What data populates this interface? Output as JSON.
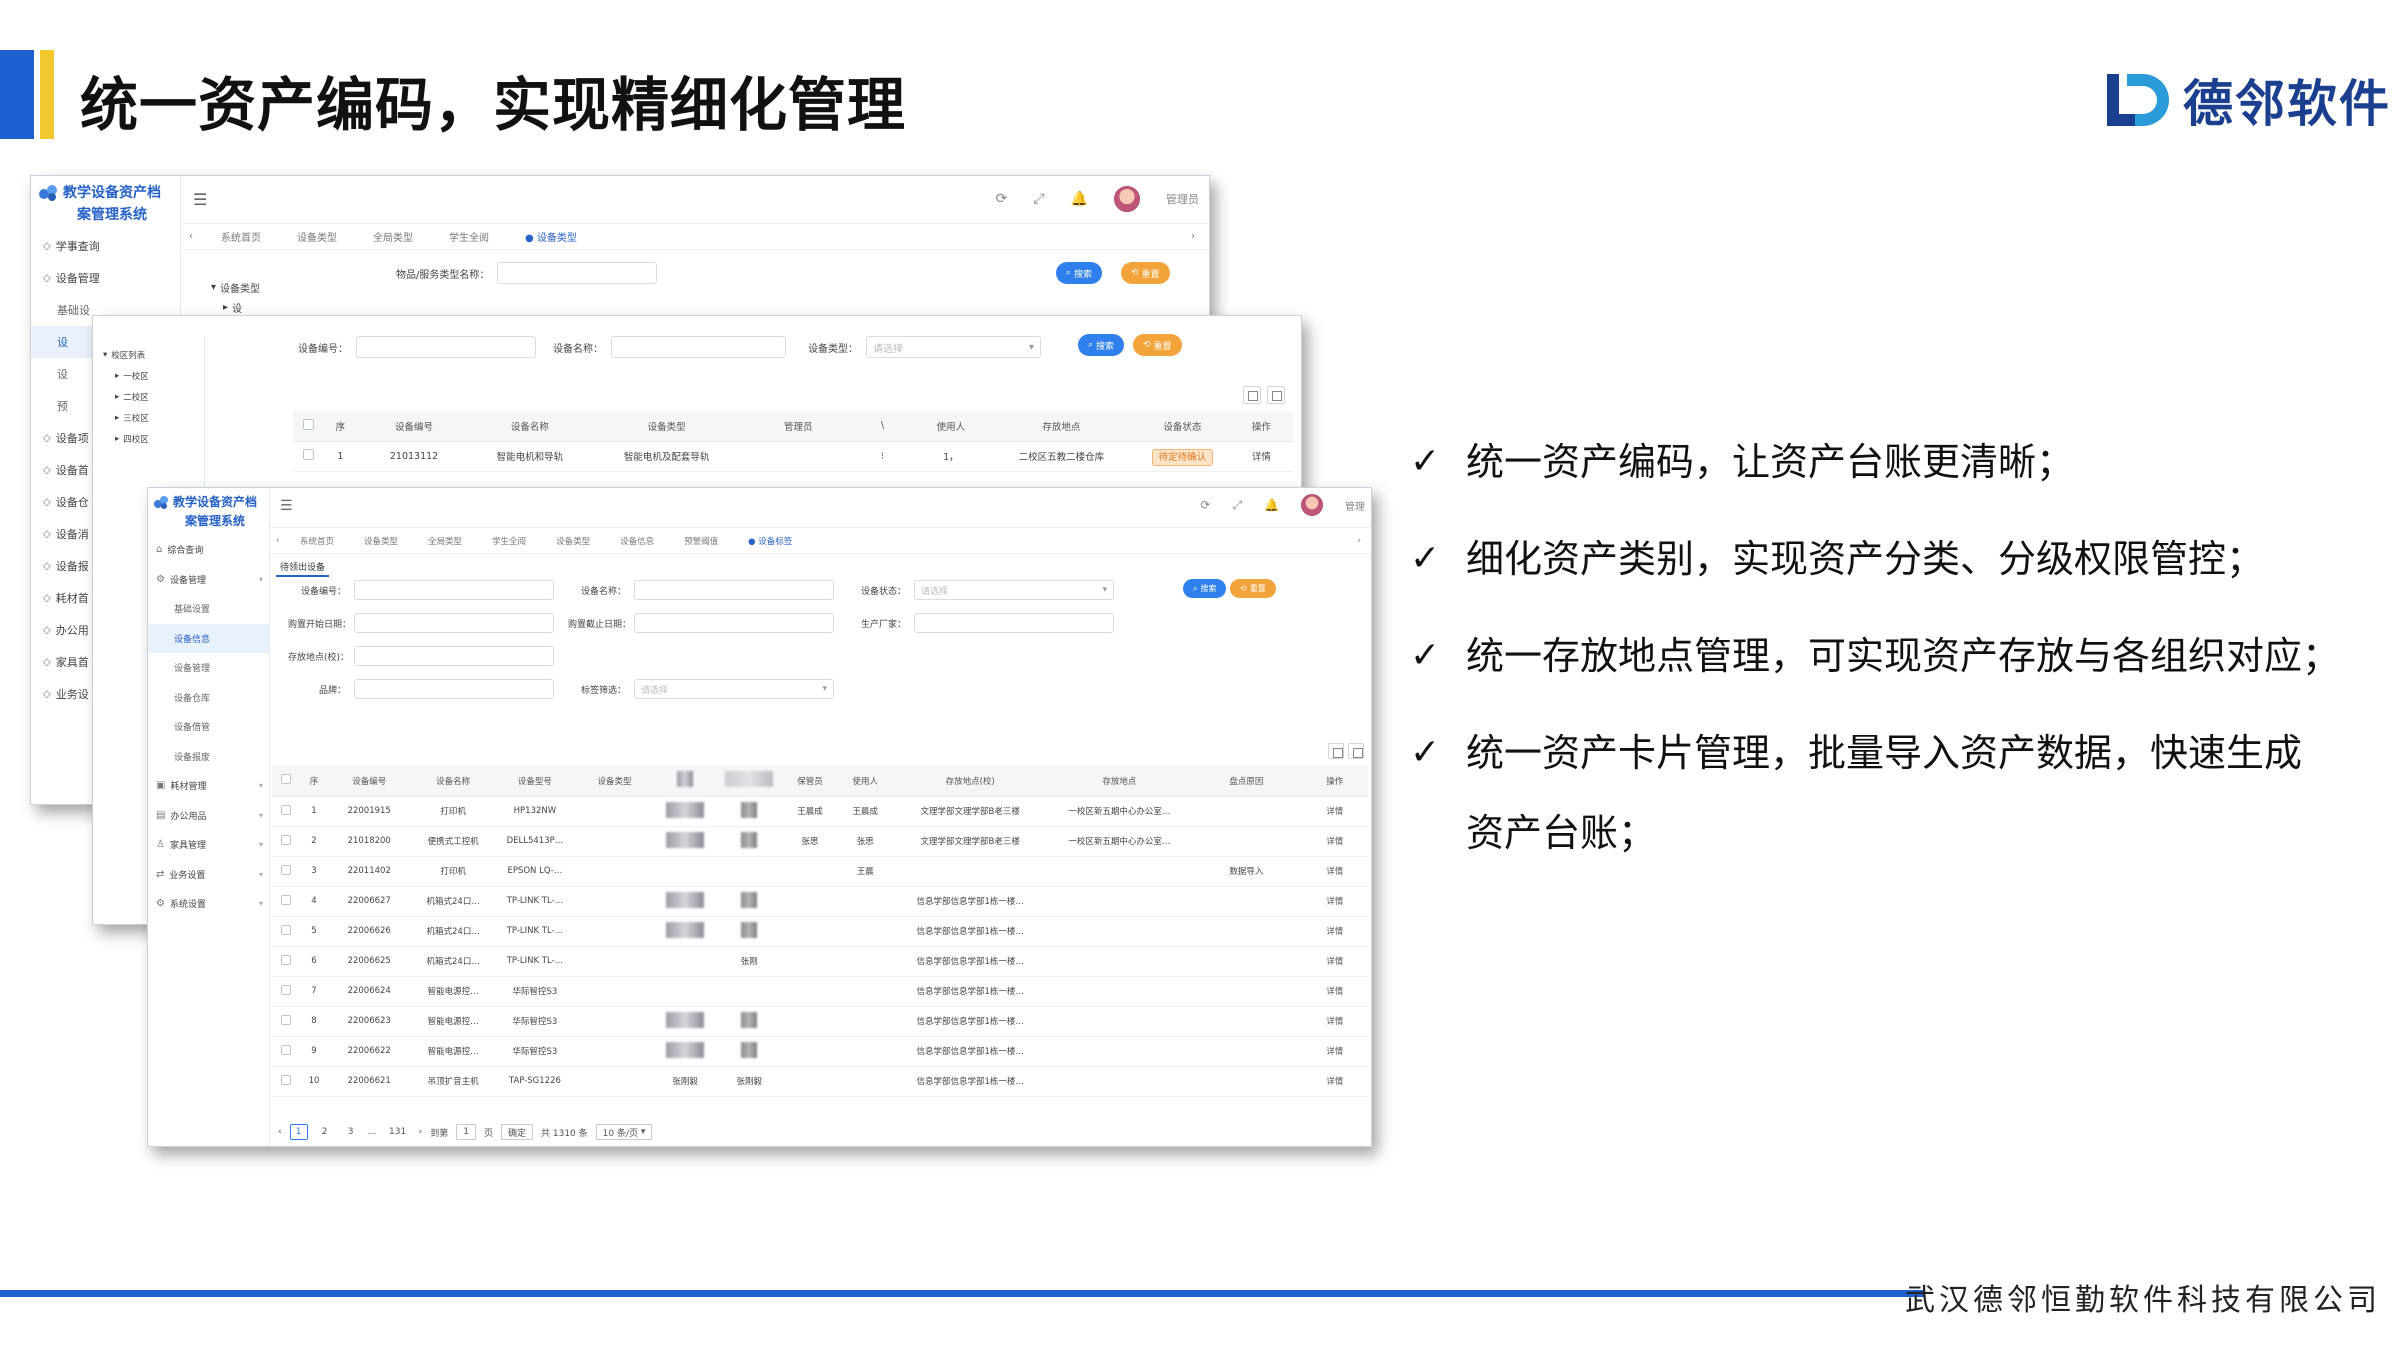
{
  "slide": {
    "title": "统一资产编码，实现精细化管理",
    "brand_name": "德邻软件",
    "company": "武汉德邻恒勤软件科技有限公司",
    "colors": {
      "accent_blue": "#1e5fcf",
      "accent_yellow": "#f3c72e",
      "brand": "#1a3f8f"
    }
  },
  "bullets": [
    {
      "icon": "check-icon",
      "glyph": "✓",
      "text": "统一资产编码，让资产台账更清晰；"
    },
    {
      "icon": "check-icon",
      "glyph": "✓",
      "text": "细化资产类别，实现资产分类、分级权限管控；"
    },
    {
      "icon": "check-icon",
      "glyph": "✓",
      "text": "统一存放地点管理，可实现资产存放与各组织对应；"
    },
    {
      "icon": "check-icon",
      "glyph": "✓",
      "text": "统一资产卡片管理，批量导入资产数据，快速生成"
    },
    {
      "icon": "",
      "glyph": "",
      "text": "资产台账；"
    }
  ],
  "win1": {
    "system_name_1": "教学设备资产档",
    "system_name_2": "案管理系统",
    "nav": [
      "学事查询",
      "设备管理",
      "基础设",
      "设",
      "设",
      "预",
      "设备项",
      "设备首",
      "设备仓",
      "设备消",
      "设备报",
      "耗材首",
      "办公用",
      "家具首",
      "业务设"
    ],
    "tabs": [
      "系统首页",
      "设备类型",
      "全局类型",
      "学生全阅",
      "设备类型"
    ],
    "search_label": "物品/服务类型名称：",
    "search_btn": "搜索",
    "reset_btn": "重置",
    "tree_root": "设备类型",
    "tree_child": "设",
    "user": "管理员"
  },
  "win2": {
    "field_code": "设备编号：",
    "field_name": "设备名称：",
    "field_type": "设备类型：",
    "type_placeholder": "请选择",
    "search_btn": "搜索",
    "reset_btn": "重置",
    "user": "管理",
    "tree": [
      "校区列表",
      "一校区",
      "二校区",
      "三校区",
      "四校区"
    ],
    "columns": [
      "序",
      "设备编号",
      "设备名称",
      "设备类型",
      "管理员",
      "\\",
      "使用人",
      "存放地点",
      "设备状态",
      "操作"
    ],
    "row": {
      "no": "1",
      "code": "21013112",
      "name": "智能电机和导轨",
      "type": "智能电机及配套导轨",
      "user": "1，",
      "place": "二校区五教二楼仓库",
      "status": "待定待确认",
      "op": "详情"
    }
  },
  "win3": {
    "system_name_1": "教学设备资产档",
    "system_name_2": "案管理系统",
    "user": "管理",
    "nav": [
      {
        "icon": "home-icon",
        "label": "综合查询"
      },
      {
        "icon": "gear-icon",
        "label": "设备管理"
      },
      {
        "icon": "",
        "label": "基础设置",
        "sub": true
      },
      {
        "icon": "",
        "label": "设备信息",
        "sub": true,
        "active": true
      },
      {
        "icon": "",
        "label": "设备管理",
        "sub": true
      },
      {
        "icon": "",
        "label": "设备仓库",
        "sub": true
      },
      {
        "icon": "",
        "label": "设备借管",
        "sub": true
      },
      {
        "icon": "",
        "label": "设备报废",
        "sub": true
      },
      {
        "icon": "box-icon",
        "label": "耗材管理"
      },
      {
        "icon": "briefcase-icon",
        "label": "办公用品"
      },
      {
        "icon": "chair-icon",
        "label": "家具管理"
      },
      {
        "icon": "flow-icon",
        "label": "业务设置"
      },
      {
        "icon": "settings-icon",
        "label": "系统设置"
      }
    ],
    "tabs": [
      "系统首页",
      "设备类型",
      "全局类型",
      "学生全阅",
      "设备类型",
      "设备信息",
      "预警阈值",
      "设备标签"
    ],
    "page_tab": "待领出设备",
    "filters": {
      "code": "设备编号：",
      "name": "设备名称：",
      "status": "设备状态：",
      "status_placeholder": "请选择",
      "buy_start": "购置开始日期：",
      "buy_end": "购置截止日期：",
      "maker": "生产厂家：",
      "place": "存放地点(校)：",
      "brand": "品牌：",
      "label_filter": "标签筛选：",
      "label_placeholder": "请选择"
    },
    "search_btn": "搜索",
    "reset_btn": "重置",
    "columns": [
      "序",
      "设备编号",
      "设备名称",
      "设备型号",
      "设备类型",
      "",
      "",
      "保管员",
      "使用人",
      "存放地点(校)",
      "存放地点",
      "盘点原因",
      "操作"
    ],
    "rows": [
      {
        "no": "1",
        "code": "22001915",
        "name": "打印机",
        "model": "HP132NW",
        "keeper": "王晨成",
        "user": "王晨成",
        "place_school": "文理学部文理学部B老三楼",
        "place": "一校区新五期中心办公室…",
        "reason": "",
        "op": "详情"
      },
      {
        "no": "2",
        "code": "21018200",
        "name": "便携式工控机",
        "model": "DELL5413P…",
        "keeper": "张思",
        "user": "张思",
        "place_school": "文理学部文理学部B老三楼",
        "place": "一校区新五期中心办公室…",
        "reason": "",
        "op": "详情"
      },
      {
        "no": "3",
        "code": "22011402",
        "name": "打印机",
        "model": "EPSON LQ-…",
        "keeper": "",
        "user": "王晨",
        "place_school": "",
        "place": "",
        "reason": "数据导入",
        "op": "详情"
      },
      {
        "no": "4",
        "code": "22006627",
        "name": "机箱式24口…",
        "model": "TP-LINK TL-…",
        "keeper": "",
        "user": "",
        "place_school": "信息学部信息学部1栋一楼…",
        "place": "",
        "reason": "",
        "op": "详情"
      },
      {
        "no": "5",
        "code": "22006626",
        "name": "机箱式24口…",
        "model": "TP-LINK TL-…",
        "keeper": "",
        "user": "",
        "place_school": "信息学部信息学部1栋一楼…",
        "place": "",
        "reason": "",
        "op": "详情"
      },
      {
        "no": "6",
        "code": "22006625",
        "name": "机箱式24口…",
        "model": "TP-LINK TL-…",
        "keeper": "",
        "user": "",
        "place_school": "信息学部信息学部1栋一楼…",
        "place": "",
        "reason": "",
        "op": "详情"
      },
      {
        "no": "7",
        "code": "22006624",
        "name": "智能电源控…",
        "model": "华际智控S3",
        "keeper": "",
        "user": "",
        "place_school": "信息学部信息学部1栋一楼…",
        "place": "",
        "reason": "",
        "op": "详情"
      },
      {
        "no": "8",
        "code": "22006623",
        "name": "智能电源控…",
        "model": "华际智控S3",
        "keeper": "",
        "user": "",
        "place_school": "信息学部信息学部1栋一楼…",
        "place": "",
        "reason": "",
        "op": "详情"
      },
      {
        "no": "9",
        "code": "22006622",
        "name": "智能电源控…",
        "model": "华际智控S3",
        "keeper": "",
        "user": "",
        "place_school": "信息学部信息学部1栋一楼…",
        "place": "",
        "reason": "",
        "op": "详情"
      },
      {
        "no": "10",
        "code": "22006621",
        "name": "吊顶扩音主机",
        "model": "TAP-SG1226",
        "keeper": "",
        "user": "",
        "place_school": "信息学部信息学部1栋一楼…",
        "place": "",
        "reason": "",
        "op": "详情"
      }
    ],
    "blur_names": {
      "r6": "张刚",
      "r10_a": "张刚毅",
      "r10_b": "张刚毅"
    },
    "pager": {
      "prev": "‹",
      "p1": "1",
      "p2": "2",
      "p3": "3",
      "ellipsis": "…",
      "last": "131",
      "next": "›",
      "goto": "到第",
      "goto_val": "1",
      "page": "页",
      "confirm": "确定",
      "total": "共 1310 条",
      "size": "10 条/页"
    }
  }
}
